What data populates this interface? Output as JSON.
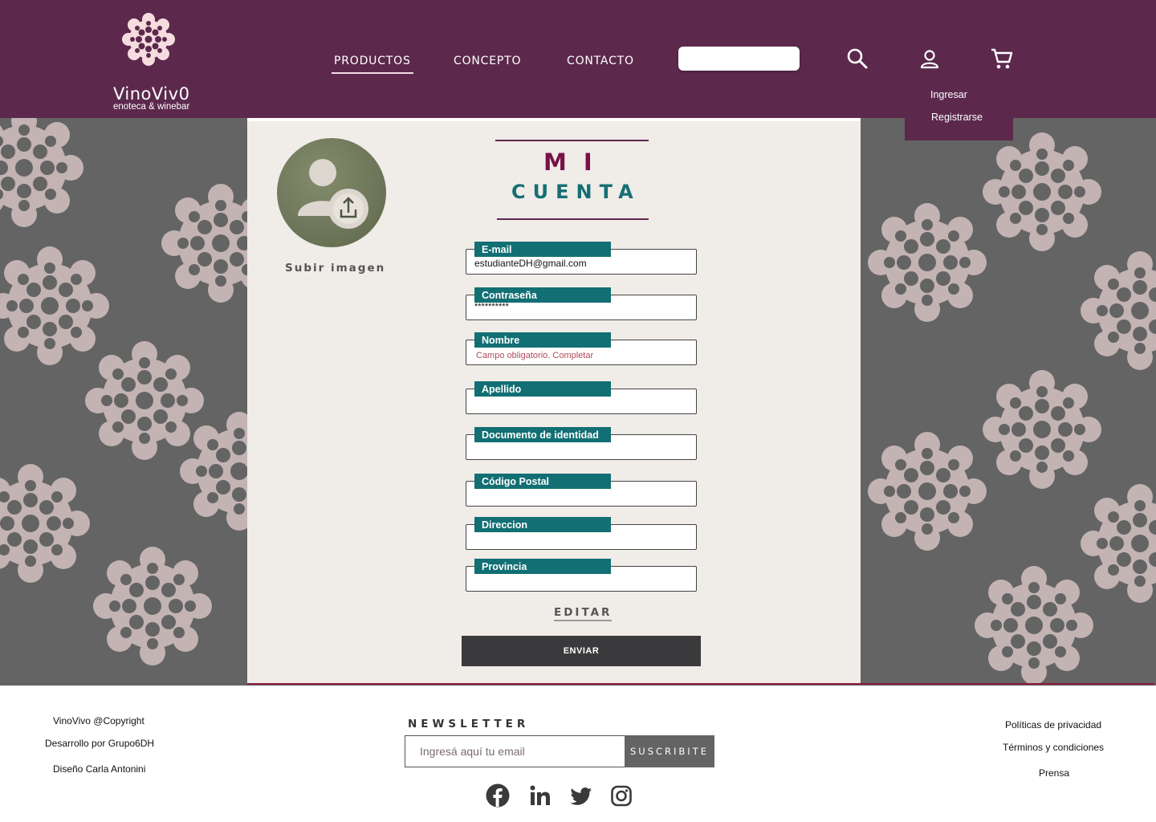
{
  "header": {
    "logo_name": "VinoViv0",
    "logo_tagline": "enoteca & winebar",
    "nav": [
      {
        "label": "PRODUCTOS",
        "active": true
      },
      {
        "label": "CONCEPTO",
        "active": false
      },
      {
        "label": "CONTACTO",
        "active": false
      }
    ],
    "search_placeholder": "",
    "icons": [
      "search-icon",
      "user-icon",
      "cart-icon"
    ],
    "user_menu": [
      "Ingresar",
      "Registrarse"
    ]
  },
  "profile": {
    "upload_label": "Subir imagen",
    "title_line1": "MI",
    "title_line2": "CUENTA",
    "fields": [
      {
        "label": "E-mail",
        "value": "estudianteDH@gmail.com",
        "error": false
      },
      {
        "label": "Contraseña",
        "value": "**********",
        "error": false
      },
      {
        "label": "Nombre",
        "value": "Campo obligatorio. Completar",
        "error": true
      },
      {
        "label": "Apellido",
        "value": "",
        "error": false
      },
      {
        "label": "Documento de identidad",
        "value": "",
        "error": false
      },
      {
        "label": "Código Postal",
        "value": "",
        "error": false
      },
      {
        "label": "Direccion",
        "value": "",
        "error": false
      },
      {
        "label": "Provincia",
        "value": "",
        "error": false
      }
    ],
    "edit_label": "EDITAR",
    "submit_label": "ENVIAR"
  },
  "footer": {
    "left": [
      "VinoVivo @Copyright",
      "Desarrollo por Grupo6DH",
      "Diseño Carla Antonini"
    ],
    "newsletter_title": "NEWSLETTER",
    "newsletter_placeholder": "Ingresá aquí tu email",
    "newsletter_button": "SUSCRIBITE",
    "social": [
      "facebook-icon",
      "linkedin-icon",
      "twitter-icon",
      "instagram-icon"
    ],
    "right": [
      "Políticas de privacidad",
      "Términos y condiciones",
      "Prensa"
    ]
  },
  "colors": {
    "brand": "#5c294d",
    "teal": "#126f73",
    "title_accent": "#7a1048",
    "pattern_bg": "#646464",
    "card_bg": "#f0ece8"
  }
}
